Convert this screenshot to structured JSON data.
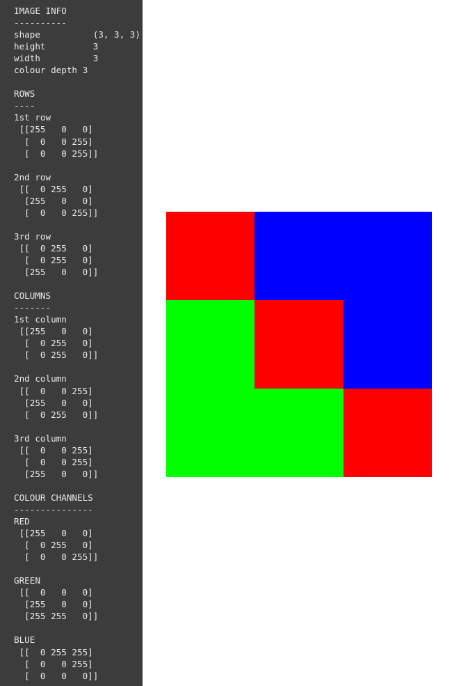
{
  "panel": {
    "sections": [
      {
        "heading": "IMAGE INFO",
        "rule": "----------",
        "lines": [
          "shape          (3, 3, 3)",
          "height         3",
          "width          3",
          "colour depth 3"
        ]
      },
      {
        "heading": "ROWS",
        "rule": "----",
        "groups": [
          {
            "label": "1st row",
            "rows": [
              " [[255   0   0]",
              "  [  0   0 255]",
              "  [  0   0 255]]"
            ]
          },
          {
            "label": "2nd row",
            "rows": [
              " [[  0 255   0]",
              "  [255   0   0]",
              "  [  0   0 255]]"
            ]
          },
          {
            "label": "3rd row",
            "rows": [
              " [[  0 255   0]",
              "  [  0 255   0]",
              "  [255   0   0]]"
            ]
          }
        ]
      },
      {
        "heading": "COLUMNS",
        "rule": "-------",
        "groups": [
          {
            "label": "1st column",
            "rows": [
              " [[255   0   0]",
              "  [  0 255   0]",
              "  [  0 255   0]]"
            ]
          },
          {
            "label": "2nd column",
            "rows": [
              " [[  0   0 255]",
              "  [255   0   0]",
              "  [  0 255   0]]"
            ]
          },
          {
            "label": "3rd column",
            "rows": [
              " [[  0   0 255]",
              "  [  0   0 255]",
              "  [255   0   0]]"
            ]
          }
        ]
      },
      {
        "heading": "COLOUR CHANNELS",
        "rule": "---------------",
        "groups": [
          {
            "label": "RED",
            "rows": [
              " [[255   0   0]",
              "  [  0 255   0]",
              "  [  0   0 255]]"
            ]
          },
          {
            "label": "GREEN",
            "rows": [
              " [[  0   0   0]",
              "  [255   0   0]",
              "  [255 255   0]]"
            ]
          },
          {
            "label": "BLUE",
            "rows": [
              " [[  0 255 255]",
              "  [  0   0 255]",
              "  [  0   0   0]]"
            ]
          }
        ]
      }
    ]
  },
  "colors": {
    "panel_background": "#3c3c3c",
    "panel_text": "#e9e9e9",
    "canvas_background": "#ffffff",
    "red": "#ff0000",
    "green": "#00ff00",
    "blue": "#0000ff"
  },
  "image_preview": {
    "shape": [
      3,
      3,
      3
    ],
    "height": 3,
    "width": 3,
    "colour_depth": 3,
    "pixels": [
      [
        [
          255,
          0,
          0
        ],
        [
          0,
          0,
          255
        ],
        [
          0,
          0,
          255
        ]
      ],
      [
        [
          0,
          255,
          0
        ],
        [
          255,
          0,
          0
        ],
        [
          0,
          0,
          255
        ]
      ],
      [
        [
          0,
          255,
          0
        ],
        [
          0,
          255,
          0
        ],
        [
          255,
          0,
          0
        ]
      ]
    ],
    "hex": [
      [
        "#ff0000",
        "#0000ff",
        "#0000ff"
      ],
      [
        "#00ff00",
        "#ff0000",
        "#0000ff"
      ],
      [
        "#00ff00",
        "#00ff00",
        "#ff0000"
      ]
    ]
  }
}
